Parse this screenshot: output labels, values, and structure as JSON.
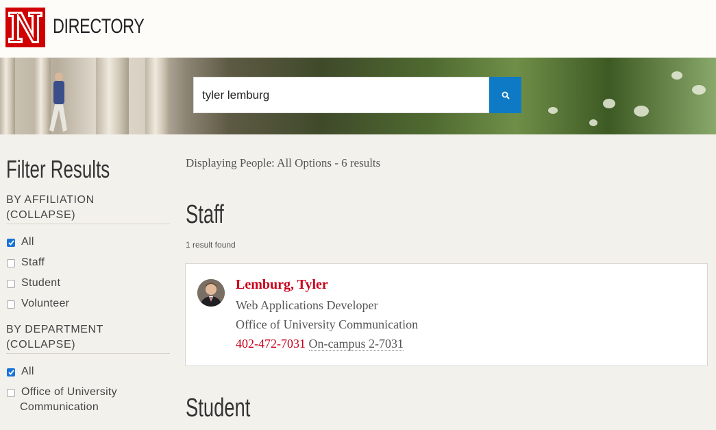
{
  "header": {
    "site_title": "DIRECTORY",
    "logo_letter": "N"
  },
  "search": {
    "value": "tyler lemburg",
    "button_icon": "search-icon"
  },
  "sidebar": {
    "title": "Filter Results",
    "affiliation": {
      "heading": "BY AFFILIATION",
      "collapse": "(COLLAPSE)",
      "options": [
        {
          "label": "All",
          "checked": true
        },
        {
          "label": "Staff",
          "checked": false
        },
        {
          "label": "Student",
          "checked": false
        },
        {
          "label": "Volunteer",
          "checked": false
        }
      ]
    },
    "department": {
      "heading": "BY DEPARTMENT",
      "collapse": "(COLLAPSE)",
      "options": [
        {
          "label": "All",
          "checked": true
        },
        {
          "label_line1": "Office of University",
          "label_line2": "Communication",
          "checked": false
        }
      ]
    }
  },
  "main": {
    "displaying": "Displaying People: All Options - 6 results",
    "groups": [
      {
        "title": "Staff",
        "count_text": "1 result found",
        "results": [
          {
            "name": "Lemburg, Tyler",
            "title": "Web Applications Developer",
            "department": "Office of University Communication",
            "phone": "402-472-7031",
            "oncampus": "On-campus 2-7031"
          }
        ]
      },
      {
        "title": "Student"
      }
    ]
  },
  "colors": {
    "brand_red": "#c8001b",
    "search_blue": "#0e7ac6",
    "checkbox_blue": "#1a73d9"
  }
}
